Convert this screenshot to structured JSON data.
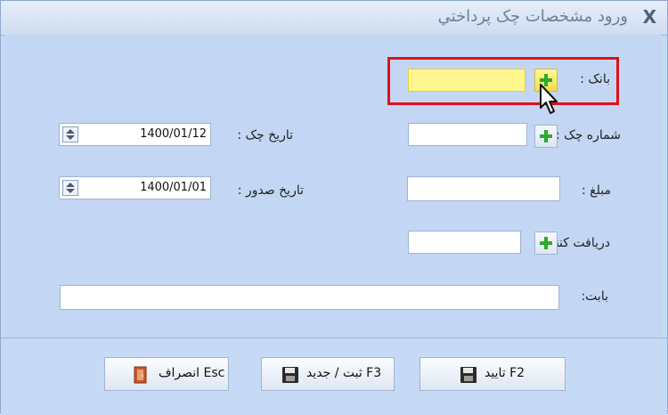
{
  "window": {
    "title": "ورود مشخصات چک پرداختي",
    "close": "X"
  },
  "form": {
    "bank_label": "بانک :",
    "check_no_label": "شماره چک :",
    "amount_label": "مبلغ :",
    "receiver_label": "دريافت کننده :",
    "for_label": "بابت:",
    "check_date_label": "تاريخ چک :",
    "check_date_value": "1400/01/12",
    "issue_date_label": "تاريخ صدور :",
    "issue_date_value": "1400/01/01"
  },
  "buttons": {
    "confirm": "تاييد F2",
    "save_new": "ثبت / جديد F3",
    "cancel": "انصراف Esc"
  },
  "colors": {
    "accent_green": "#2eaa2e",
    "highlight_red": "#e0101a",
    "active_field": "#fff690"
  }
}
